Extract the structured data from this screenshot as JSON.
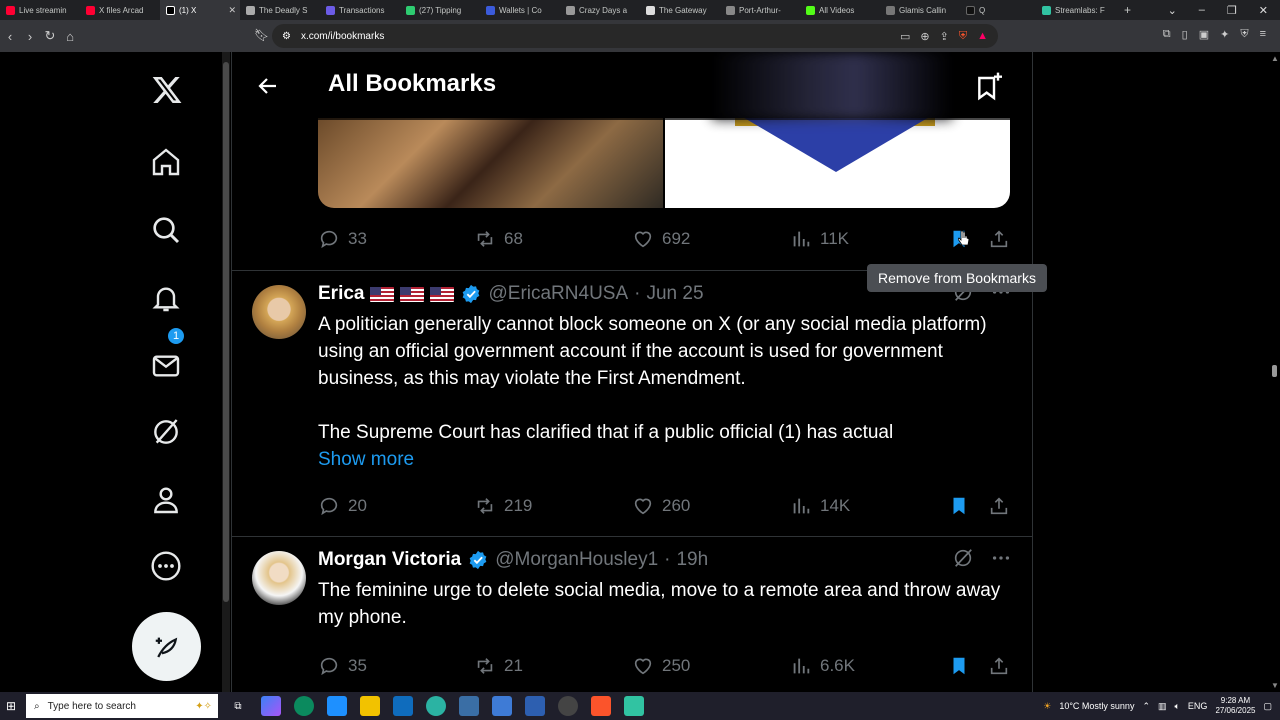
{
  "browser": {
    "tabs": [
      {
        "label": "Live streamin",
        "color": "#ff0033",
        "active": false
      },
      {
        "label": "X files Arcad",
        "color": "#ff0033",
        "active": false
      },
      {
        "label": "(1) X",
        "color": "#ffffff",
        "active": true
      },
      {
        "label": "The Deadly S",
        "color": "#aaaaaa",
        "active": false
      },
      {
        "label": "Transactions",
        "color": "#6c5ce7",
        "active": false
      },
      {
        "label": "(27) Tipping",
        "color": "#2ecc71",
        "active": false
      },
      {
        "label": "Wallets | Co",
        "color": "#3b5bdb",
        "active": false
      },
      {
        "label": "Crazy Days a",
        "color": "#999999",
        "active": false
      },
      {
        "label": "The Gateway",
        "color": "#dddddd",
        "active": false
      },
      {
        "label": "Port-Arthur-",
        "color": "#888888",
        "active": false
      },
      {
        "label": "All Videos",
        "color": "#53fc18",
        "active": false
      },
      {
        "label": "Glamis Callin",
        "color": "#777777",
        "active": false
      },
      {
        "label": "Q",
        "color": "#111111",
        "active": false
      },
      {
        "label": "Streamlabs: F",
        "color": "#31c3a2",
        "active": false
      }
    ],
    "url": "x.com/i/bookmarks",
    "new_tab": "+"
  },
  "header": {
    "title": "All Bookmarks"
  },
  "top_post": {
    "replies": "33",
    "reposts": "68",
    "likes": "692",
    "views": "11K"
  },
  "tooltip": "Remove from Bookmarks",
  "tweets": [
    {
      "name": "Erica",
      "handle": "@EricaRN4USA",
      "sep": "·",
      "time": "Jun 25",
      "body1": "A politician generally cannot block someone on X (or any social media platform) using an official government account if the account is used for government business, as this may violate the First Amendment.",
      "body2": "The Supreme Court has clarified that if a public official (1) has actual",
      "show_more": "Show more",
      "replies": "20",
      "reposts": "219",
      "likes": "260",
      "views": "14K"
    },
    {
      "name": "Morgan Victoria",
      "handle": "@MorganHousley1",
      "sep": "·",
      "time": "19h",
      "body1": "The feminine urge to delete social media, move to a remote area and throw away my phone.",
      "replies": "35",
      "reposts": "21",
      "likes": "250",
      "views": "6.6K"
    }
  ],
  "notifications_badge": "1",
  "taskbar": {
    "search_placeholder": "Type here to search",
    "weather": "10°C  Mostly sunny",
    "lang": "ENG",
    "time": "9:28 AM",
    "date": "27/06/2025"
  },
  "colors": {
    "accent": "#1d9bf0",
    "muted": "#71767b",
    "border": "#2f3336"
  }
}
